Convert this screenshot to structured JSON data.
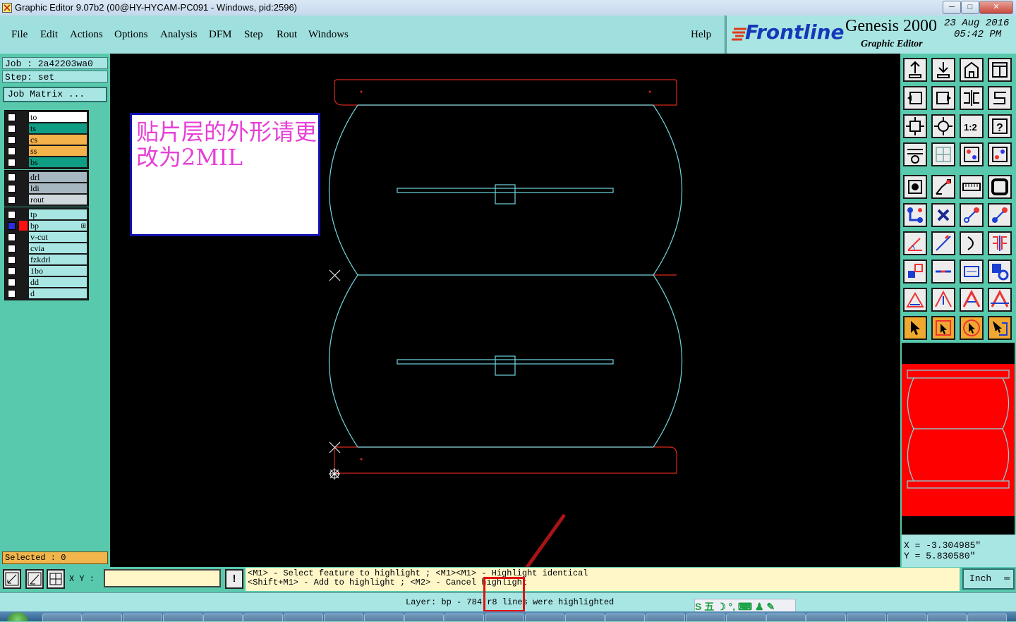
{
  "window": {
    "title": "Graphic Editor 9.07b2 (00@HY-HYCAM-PC091 - Windows, pid:2596)",
    "minimize": "─",
    "maximize": "□",
    "close": "✕"
  },
  "menu": {
    "items": [
      "File",
      "Edit",
      "Actions",
      "Options",
      "Analysis",
      "DFM",
      "Step",
      "Rout",
      "Windows"
    ],
    "help": "Help"
  },
  "branding": {
    "logo": "Frontline",
    "product": "Genesis 2000",
    "subtitle": "Graphic Editor",
    "date": "23 Aug 2016",
    "time": "05:42 PM"
  },
  "job": {
    "job_label": "Job  : 2a42203wa0",
    "step_label": "Step: set",
    "matrix_button": "Job Matrix ..."
  },
  "layers": {
    "group1": [
      {
        "name": "to",
        "color": "#ffffff"
      },
      {
        "name": "ts",
        "color": "#0f9e84"
      },
      {
        "name": "cs",
        "color": "#f4b24a"
      },
      {
        "name": "ss",
        "color": "#f4b24a"
      },
      {
        "name": "bs",
        "color": "#0f9e84"
      }
    ],
    "group2": [
      {
        "name": "drl",
        "color": "#a7b7c2"
      },
      {
        "name": "ldi",
        "color": "#a7b7c2"
      },
      {
        "name": "rout",
        "color": "#cfd9dd"
      }
    ],
    "group3": [
      {
        "name": "tp",
        "color": "#a8e6e4"
      },
      {
        "name": "bp",
        "color": "#a8e6e4",
        "mark": "⊞"
      },
      {
        "name": "v-cut",
        "color": "#a8e6e4"
      },
      {
        "name": "cvia",
        "color": "#a8e6e4"
      },
      {
        "name": "fzkdrl",
        "color": "#a8e6e4"
      },
      {
        "name": "1bo",
        "color": "#a8e6e4"
      },
      {
        "name": "dd",
        "color": "#a8e6e4"
      },
      {
        "name": "d",
        "color": "#a8e6e4"
      }
    ]
  },
  "selected": "Selected : 0",
  "note": "贴片层的外形请更改为2MIL",
  "coords": {
    "x": "X  = -3.304985\"",
    "y": "Y  = 5.830580\""
  },
  "bottom": {
    "xy_label": "X Y :",
    "xy_value": "",
    "alert": "!",
    "message_line1": "<M1> - Select feature to highlight ; <M1><M1> - Highlight identical",
    "message_line2": "<Shift+M1> - Add to highlight ; <M2> - Cancel highlight",
    "units": "Inch",
    "status": "Layer: bp - 784 r8 lines were highlighted"
  },
  "ime": {
    "text": "S 五 ☽ °, ⌨ ♟ ✎"
  },
  "colors": {
    "accent_teal": "#58c9ad",
    "panel_light": "#a8e6e4",
    "profile_red": "#d8281e",
    "outline_cyan": "#6fd6de",
    "preview_red": "#ff0000"
  }
}
